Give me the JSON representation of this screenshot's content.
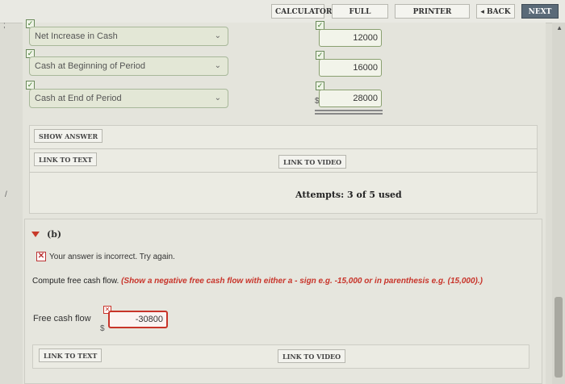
{
  "topbar": {
    "calculator": "CALCULATOR",
    "full_screen": "FULL SCREEN",
    "printer_version": "PRINTER VERSION",
    "back": "◂ BACK",
    "next": "NEXT ▸"
  },
  "rows": [
    {
      "select": "Net Increase in Cash",
      "value": "12000"
    },
    {
      "select": "Cash at Beginning of Period",
      "value": "16000"
    },
    {
      "select": "Cash at End of Period",
      "value": "28000"
    }
  ],
  "currency": "$",
  "panel_a": {
    "show_answer": "SHOW ANSWER",
    "link_to_text": "LINK TO TEXT",
    "link_to_video": "LINK TO VIDEO",
    "attempts": "Attempts: 3 of 5 used"
  },
  "part_b": {
    "label": "(b)",
    "feedback": "Your answer is incorrect.  Try again.",
    "question": "Compute free cash flow.",
    "hint": "(Show a negative free cash flow with either a - sign e.g. -15,000 or in parenthesis e.g. (15,000).)",
    "field_label": "Free cash flow",
    "field_value": "-30800",
    "link_to_text": "LINK TO TEXT",
    "link_to_video": "LINK TO VIDEO"
  },
  "icons": {
    "check": "check-icon",
    "error": "error-x-icon",
    "dropdown": "chevron-down-icon"
  },
  "colors": {
    "error_red": "#c8342a",
    "correct_green": "#3e7a2a",
    "next_button": "#5a6a78"
  }
}
